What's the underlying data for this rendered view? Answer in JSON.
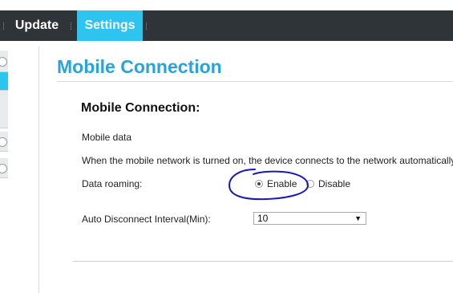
{
  "nav": {
    "tabs": [
      {
        "label": "Update",
        "active": false
      },
      {
        "label": "Settings",
        "active": true
      }
    ]
  },
  "page": {
    "title": "Mobile Connection"
  },
  "section": {
    "title": "Mobile Connection:",
    "mobile_data_label": "Mobile data",
    "description": "When the mobile network is turned on, the device connects to the network automatically.",
    "data_roaming": {
      "label": "Data roaming:",
      "options": [
        "Enable",
        "Disable"
      ],
      "selected": "Enable"
    },
    "auto_disconnect": {
      "label": "Auto Disconnect Interval(Min):",
      "value": "10"
    }
  },
  "colors": {
    "accent": "#2ec4f0",
    "title": "#2aa3d8",
    "nav_bg": "#2f3438",
    "annotation": "#1a1ab8"
  }
}
